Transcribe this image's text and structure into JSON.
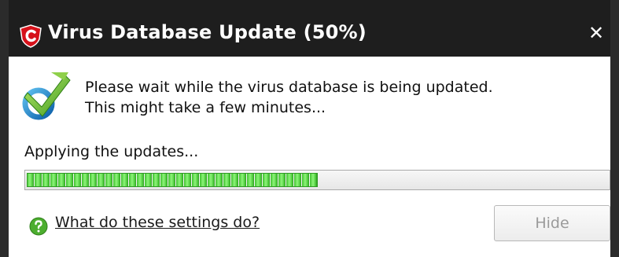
{
  "window": {
    "title": "Virus Database Update (50%)",
    "close_glyph": "✕"
  },
  "message": {
    "line1": "Please wait while the virus database is being updated.",
    "line2": "This might take a few minutes..."
  },
  "status_text": "Applying the updates...",
  "progress": {
    "percent": 50
  },
  "help": {
    "link_text": "What do these settings do?",
    "icon": "help-question-icon"
  },
  "buttons": {
    "hide_label": "Hide",
    "hide_disabled": true
  },
  "icons": {
    "app_logo": "comodo-shield-icon",
    "update": "update-checkmark-icon"
  },
  "colors": {
    "titlebar": "#1e1e1e",
    "progress_green": "#3fbf2e",
    "logo_red": "#d6111a"
  }
}
